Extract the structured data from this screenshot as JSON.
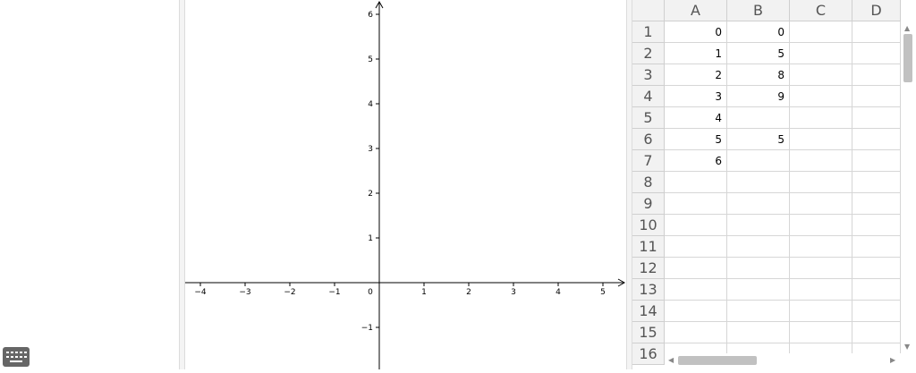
{
  "graphics": {
    "x_ticks": [
      "−4",
      "−3",
      "−2",
      "−1",
      "0",
      "1",
      "2",
      "3",
      "4",
      "5"
    ],
    "y_ticks": [
      "6",
      "5",
      "4",
      "3",
      "2",
      "1",
      "−1"
    ]
  },
  "spreadsheet": {
    "columns": [
      "A",
      "B",
      "C",
      "D"
    ],
    "rows": [
      "1",
      "2",
      "3",
      "4",
      "5",
      "6",
      "7",
      "8",
      "9",
      "10",
      "11",
      "12",
      "13",
      "14",
      "15",
      "16"
    ],
    "cells": [
      [
        "0",
        "0",
        "",
        ""
      ],
      [
        "1",
        "5",
        "",
        ""
      ],
      [
        "2",
        "8",
        "",
        ""
      ],
      [
        "3",
        "9",
        "",
        ""
      ],
      [
        "4",
        "",
        "",
        ""
      ],
      [
        "5",
        "5",
        "",
        ""
      ],
      [
        "6",
        "",
        "",
        ""
      ],
      [
        "",
        "",
        "",
        ""
      ],
      [
        "",
        "",
        "",
        ""
      ],
      [
        "",
        "",
        "",
        ""
      ],
      [
        "",
        "",
        "",
        ""
      ],
      [
        "",
        "",
        "",
        ""
      ],
      [
        "",
        "",
        "",
        ""
      ],
      [
        "",
        "",
        "",
        ""
      ],
      [
        "",
        "",
        "",
        ""
      ],
      [
        "",
        "",
        "",
        ""
      ]
    ]
  },
  "icons": {
    "keyboard": "keyboard-icon",
    "scroll_up": "scroll-up-arrow-icon",
    "scroll_down": "scroll-down-arrow-icon",
    "scroll_left": "scroll-left-arrow-icon",
    "scroll_right": "scroll-right-arrow-icon"
  }
}
